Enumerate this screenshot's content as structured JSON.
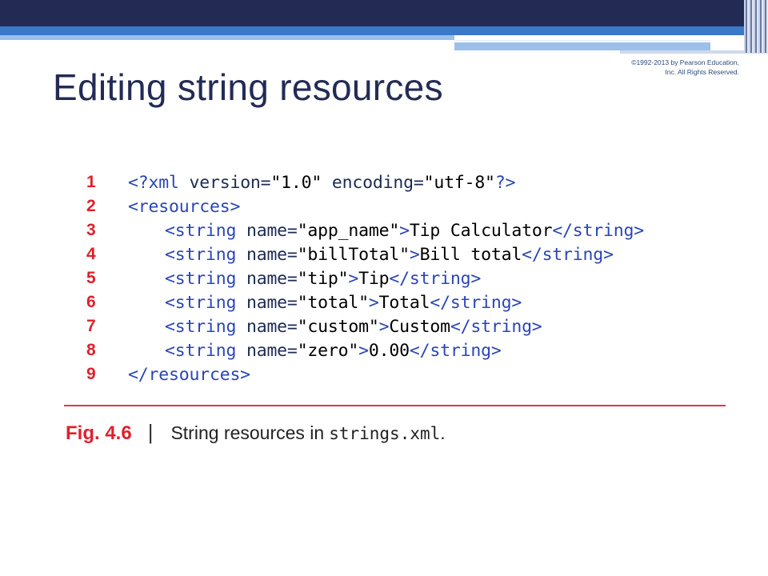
{
  "copyright": "©1992-2013 by Pearson Education, Inc. All Rights Reserved.",
  "title": "Editing string resources",
  "code_lines": [
    {
      "num": "1",
      "indent": 0,
      "parts": [
        {
          "t": "<?xml ",
          "c": "tag"
        },
        {
          "t": "version=",
          "c": "attr"
        },
        {
          "t": "\"1.0\" ",
          "c": "val"
        },
        {
          "t": "encoding=",
          "c": "attr"
        },
        {
          "t": "\"utf-8\"",
          "c": "val"
        },
        {
          "t": "?>",
          "c": "tag"
        }
      ]
    },
    {
      "num": "2",
      "indent": 0,
      "parts": [
        {
          "t": "<resources>",
          "c": "tag"
        }
      ]
    },
    {
      "num": "3",
      "indent": 1,
      "parts": [
        {
          "t": "<string ",
          "c": "tag"
        },
        {
          "t": "name=",
          "c": "attr"
        },
        {
          "t": "\"app_name\"",
          "c": "val"
        },
        {
          "t": ">",
          "c": "tag"
        },
        {
          "t": "Tip Calculator",
          "c": "txt"
        },
        {
          "t": "</string>",
          "c": "tag"
        }
      ]
    },
    {
      "num": "4",
      "indent": 1,
      "parts": [
        {
          "t": "<string ",
          "c": "tag"
        },
        {
          "t": "name=",
          "c": "attr"
        },
        {
          "t": "\"billTotal\"",
          "c": "val"
        },
        {
          "t": ">",
          "c": "tag"
        },
        {
          "t": "Bill total",
          "c": "txt"
        },
        {
          "t": "</string>",
          "c": "tag"
        }
      ]
    },
    {
      "num": "5",
      "indent": 1,
      "parts": [
        {
          "t": "<string ",
          "c": "tag"
        },
        {
          "t": "name=",
          "c": "attr"
        },
        {
          "t": "\"tip\"",
          "c": "val"
        },
        {
          "t": ">",
          "c": "tag"
        },
        {
          "t": "Tip",
          "c": "txt"
        },
        {
          "t": "</string>",
          "c": "tag"
        }
      ]
    },
    {
      "num": "6",
      "indent": 1,
      "parts": [
        {
          "t": "<string ",
          "c": "tag"
        },
        {
          "t": "name=",
          "c": "attr"
        },
        {
          "t": "\"total\"",
          "c": "val"
        },
        {
          "t": ">",
          "c": "tag"
        },
        {
          "t": "Total",
          "c": "txt"
        },
        {
          "t": "</string>",
          "c": "tag"
        }
      ]
    },
    {
      "num": "7",
      "indent": 1,
      "parts": [
        {
          "t": "<string ",
          "c": "tag"
        },
        {
          "t": "name=",
          "c": "attr"
        },
        {
          "t": "\"custom\"",
          "c": "val"
        },
        {
          "t": ">",
          "c": "tag"
        },
        {
          "t": "Custom",
          "c": "txt"
        },
        {
          "t": "</string>",
          "c": "tag"
        }
      ]
    },
    {
      "num": "8",
      "indent": 1,
      "parts": [
        {
          "t": "<string ",
          "c": "tag"
        },
        {
          "t": "name=",
          "c": "attr"
        },
        {
          "t": "\"zero\"",
          "c": "val"
        },
        {
          "t": ">",
          "c": "tag"
        },
        {
          "t": "0.00",
          "c": "txt"
        },
        {
          "t": "</string>",
          "c": "tag"
        }
      ]
    },
    {
      "num": "9",
      "indent": 0,
      "parts": [
        {
          "t": "</resources>",
          "c": "tag"
        }
      ]
    }
  ],
  "caption": {
    "label": "Fig. 4.6",
    "separator": "|",
    "text": "String resources in",
    "code": "strings.xml",
    "end": "."
  },
  "colors": {
    "title": "#232b55",
    "accent_red": "#e0202c",
    "xml_tag": "#2946b8",
    "header_navy": "#232b55",
    "header_blue": "#3a78c8"
  }
}
